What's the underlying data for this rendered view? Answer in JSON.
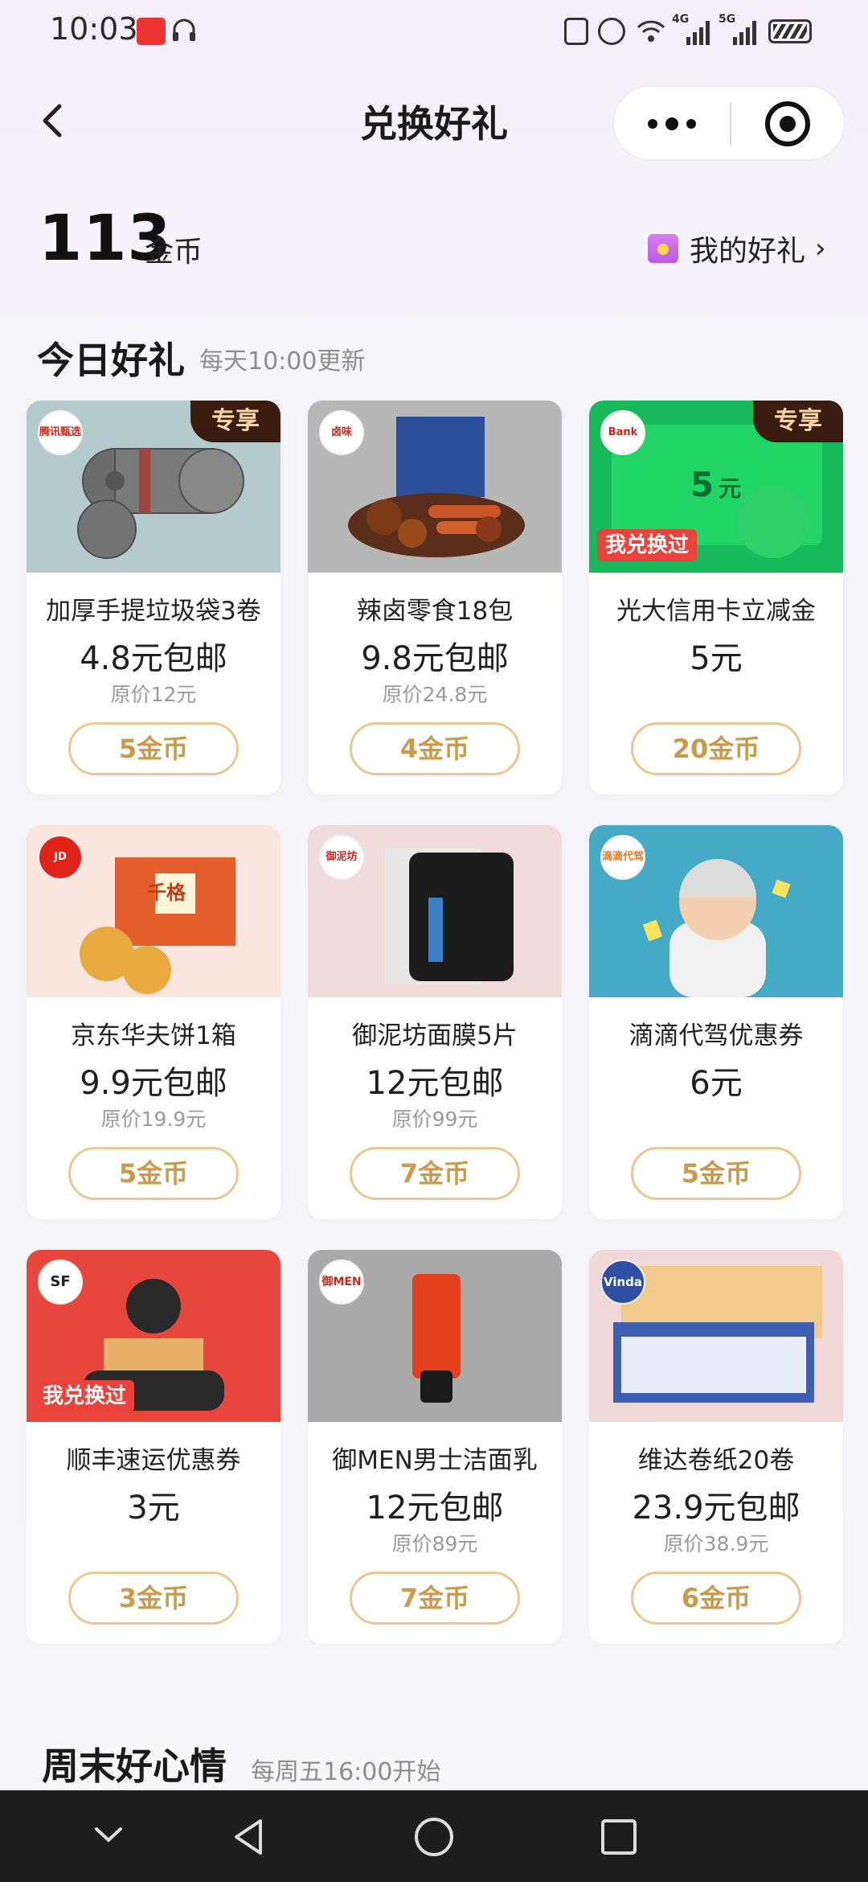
{
  "status": {
    "time": "10:03",
    "network_4g": "4G",
    "network_5g": "5G"
  },
  "header": {
    "title": "兑换好礼"
  },
  "coins": {
    "amount": "113",
    "unit": "金币"
  },
  "my_gifts": {
    "label": "我的好礼",
    "chevron": "›"
  },
  "today": {
    "title": "今日好礼",
    "subtitle": "每天10:00更新"
  },
  "weekend": {
    "title": "周末好心情",
    "subtitle": "每周五16:00开始"
  },
  "products": [
    {
      "name": "加厚手提垃圾袋3卷",
      "price": "4.8元包邮",
      "original": "原价12元",
      "cost": "5金币",
      "badge": "专享",
      "logo": "腾讯甄选"
    },
    {
      "name": "辣卤零食18包",
      "price": "9.8元包邮",
      "original": "原价24.8元",
      "cost": "4金币",
      "logo": "卤味"
    },
    {
      "name": "光大信用卡立减金",
      "price": "5元",
      "cost": "20金币",
      "badge": "专享",
      "exchanged": "我兑换过",
      "logo": "Bank",
      "card_value": "5",
      "card_unit": "元"
    },
    {
      "name": "京东华夫饼1箱",
      "price": "9.9元包邮",
      "original": "原价19.9元",
      "cost": "5金币",
      "logo": "JD",
      "box_text": "千格"
    },
    {
      "name": "御泥坊面膜5片",
      "price": "12元包邮",
      "original": "原价99元",
      "cost": "7金币",
      "logo": "御泥坊"
    },
    {
      "name": "滴滴代驾优惠券",
      "price": "6元",
      "cost": "5金币",
      "logo": "滴滴代驾"
    },
    {
      "name": "顺丰速运优惠券",
      "price": "3元",
      "cost": "3金币",
      "exchanged": "我兑换过",
      "logo": "SF"
    },
    {
      "name": "御MEN男士洁面乳",
      "price": "12元包邮",
      "original": "原价89元",
      "cost": "7金币",
      "logo": "御MEN"
    },
    {
      "name": "维达卷纸20卷",
      "price": "23.9元包邮",
      "original": "原价38.9元",
      "cost": "6金币",
      "logo": "Vinda"
    }
  ],
  "colors": {
    "button_border": "#e7c98f",
    "button_text": "#c99b4a",
    "badge_bg": "#3b1c11",
    "badge_text": "#f7d6a4",
    "exchanged_bg": "#e9433b"
  }
}
